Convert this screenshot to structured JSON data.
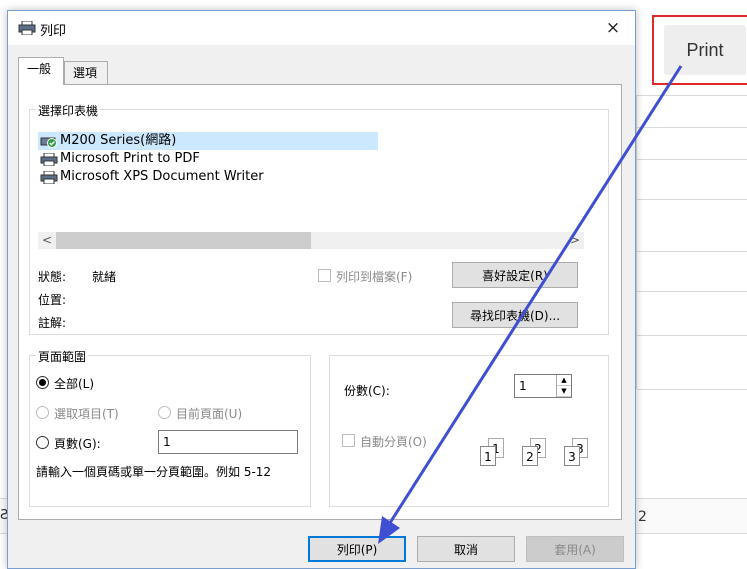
{
  "background": {
    "print_button": "Print",
    "cell_text": "2",
    "left_text": "Ƨ"
  },
  "dialog": {
    "title": "列印",
    "close": "×",
    "tabs": [
      "一般",
      "選項"
    ],
    "printer_group": {
      "legend": "選擇印表機",
      "printers": [
        "M200 Series(網路)",
        "Microsoft Print to PDF",
        "Microsoft XPS Document Writer"
      ],
      "selected_index": 0,
      "status_label": "狀態:",
      "status_value": "就緒",
      "location_label": "位置:",
      "comment_label": "註解:",
      "print_to_file": "列印到檔案(F)",
      "preferences_button": "喜好設定(R)",
      "find_printer_button": "尋找印表機(D)..."
    },
    "page_range": {
      "legend": "頁面範圍",
      "all": "全部(L)",
      "selection": "選取項目(T)",
      "current_page": "目前頁面(U)",
      "pages": "頁數(G):",
      "pages_value": "1",
      "hint": "請輸入一個頁碼或單一分頁範圍。例如 5-12"
    },
    "copies": {
      "label": "份數(C):",
      "value": "1",
      "collate": "自動分頁(O)",
      "collate_pages": [
        "1",
        "1",
        "2",
        "2",
        "3",
        "3"
      ]
    },
    "buttons": {
      "print": "列印(P)",
      "cancel": "取消",
      "apply": "套用(A)"
    }
  },
  "colors": {
    "accent": "#0078d7",
    "selection": "#cce8ff",
    "annotation_red": "#e0292b",
    "annotation_arrow": "#3f4fd1"
  }
}
